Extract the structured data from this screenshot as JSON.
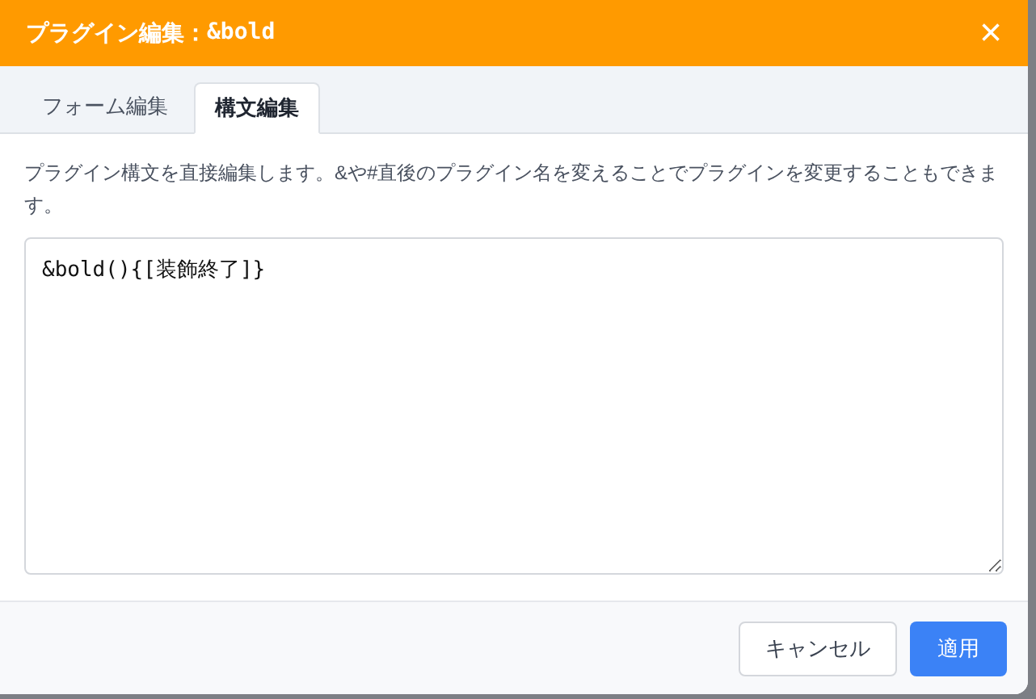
{
  "dialog": {
    "title": "プラグイン編集：",
    "plugin_name": "&bold",
    "close": "×"
  },
  "tabs": [
    {
      "label": "フォーム編集",
      "selected": false
    },
    {
      "label": "構文編集",
      "selected": true
    }
  ],
  "description": "プラグイン構文を直接編集します。&や#直後のプラグイン名を変えることでプラグインを変更することもできます。",
  "editor": {
    "value": "&bold(){[装飾終了]}"
  },
  "buttons": [
    {
      "label": "キャンセル",
      "kind": "secondary"
    },
    {
      "label": "適用",
      "kind": "primary"
    }
  ]
}
